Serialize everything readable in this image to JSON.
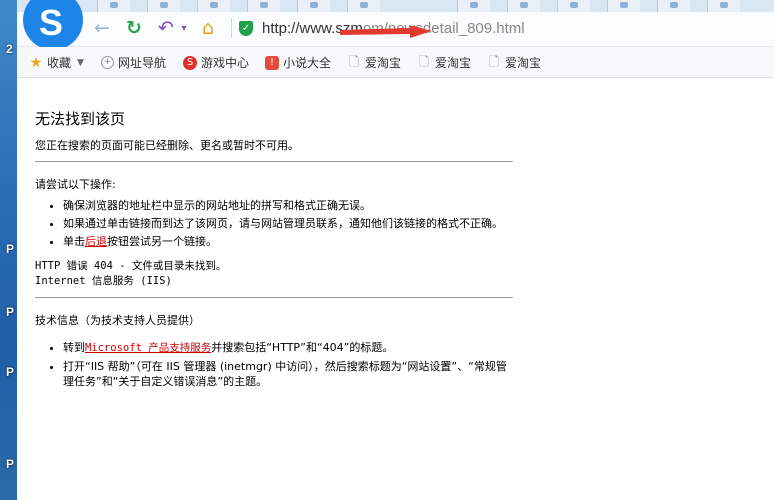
{
  "browser": {
    "url_host": "http://www.szm",
    "url_path": "om/newsdetail_809.html"
  },
  "bookmarks": [
    {
      "label": "收藏",
      "icon": "star-icon",
      "color": "#e8a317"
    },
    {
      "label": "网址导航",
      "icon": "globe-icon",
      "color": "#888888"
    },
    {
      "label": "游戏中心",
      "icon": "game-icon",
      "color": "#e0302a"
    },
    {
      "label": "小说大全",
      "icon": "book-icon",
      "color": "#e54b3c"
    },
    {
      "label": "爱淘宝",
      "icon": "page-icon",
      "color": "#999999"
    },
    {
      "label": "爱淘宝",
      "icon": "page-icon",
      "color": "#999999"
    },
    {
      "label": "爱淘宝",
      "icon": "page-icon",
      "color": "#999999"
    }
  ],
  "desktop_labels": [
    "2",
    "P",
    "P",
    "P",
    "P"
  ],
  "page": {
    "title": "无法找到该页",
    "subtitle": "您正在搜索的页面可能已经删除、更名或暂时不可用。",
    "try_heading": "请尝试以下操作:",
    "tips": [
      "确保浏览器的地址栏中显示的网站地址的拼写和格式正确无误。",
      "如果通过单击链接而到达了该网页，请与网站管理员联系，通知他们该链接的格式不正确。"
    ],
    "tip3_prefix": "单击",
    "tip3_link": "后退",
    "tip3_suffix": "按钮尝试另一个链接。",
    "error_line1": "HTTP 错误 404 - 文件或目录未找到。",
    "error_line2": "Internet 信息服务 (IIS)",
    "tech_heading": "技术信息（为技术支持人员提供）",
    "tech1_prefix": "转到",
    "tech1_link": "Microsoft 产品支持服务",
    "tech1_suffix": "并搜索包括“HTTP”和“404”的标题。",
    "tech2": "打开“IIS 帮助”（可在 IIS 管理器 (inetmgr) 中访问），然后搜索标题为“网站设置”、“常规管理任务”和“关于自定义错误消息”的主题。"
  }
}
